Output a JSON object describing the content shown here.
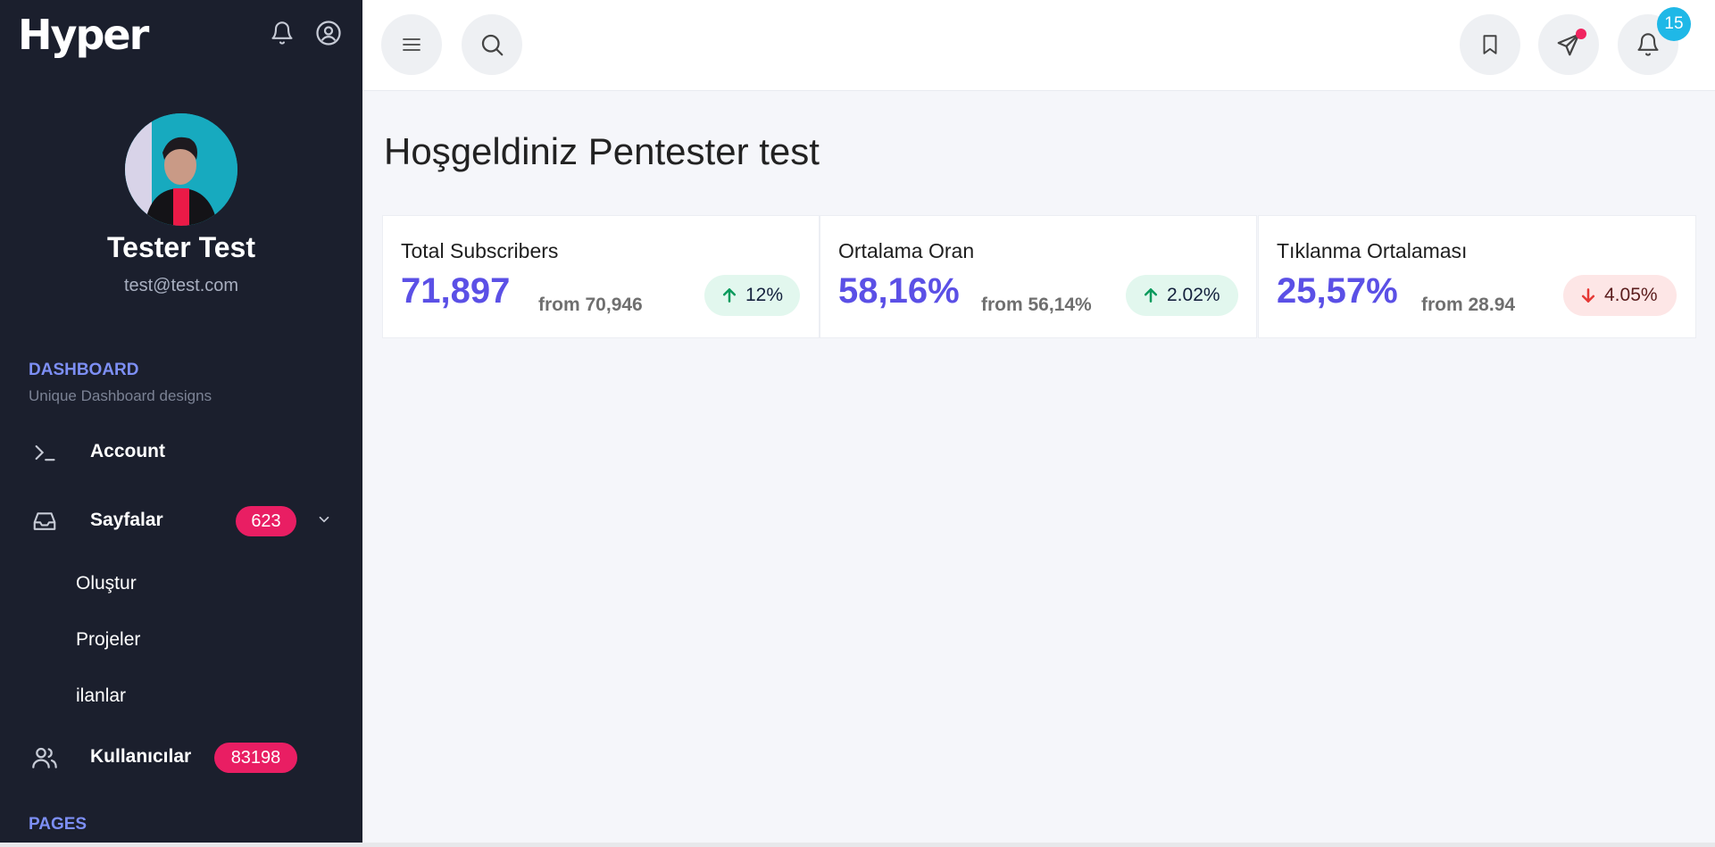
{
  "brand": "Hyper",
  "profile": {
    "name": "Tester Test",
    "email": "test@test.com"
  },
  "sidebar": {
    "section_title": "DASHBOARD",
    "section_subtitle": "Unique Dashboard designs",
    "items": [
      {
        "label": "Account",
        "icon": "terminal-icon"
      },
      {
        "label": "Sayfalar",
        "icon": "inbox-icon",
        "badge": "623",
        "children": [
          "Oluştur",
          "Projeler",
          "ilanlar"
        ]
      },
      {
        "label": "Kullanıcılar",
        "icon": "users-icon",
        "badge": "83198"
      }
    ],
    "pages_title": "PAGES"
  },
  "topbar": {
    "notification_count": "15"
  },
  "main": {
    "welcome": "Hoşgeldiniz Pentester test",
    "cards": [
      {
        "title": "Total Subscribers",
        "value": "71,897",
        "from": "from 70,946",
        "change": "12%",
        "direction": "up"
      },
      {
        "title": "Ortalama Oran",
        "value": "58,16%",
        "from": "from 56,14%",
        "change": "2.02%",
        "direction": "up"
      },
      {
        "title": "Tıklanma Ortalaması",
        "value": "25,57%",
        "from": "from 28.94",
        "change": "4.05%",
        "direction": "down"
      }
    ]
  },
  "colors": {
    "sidebar_bg": "#1b1f2d",
    "accent": "#5b50e6",
    "badge": "#e91e63",
    "up": "#0a9a5c",
    "down": "#e53935"
  }
}
